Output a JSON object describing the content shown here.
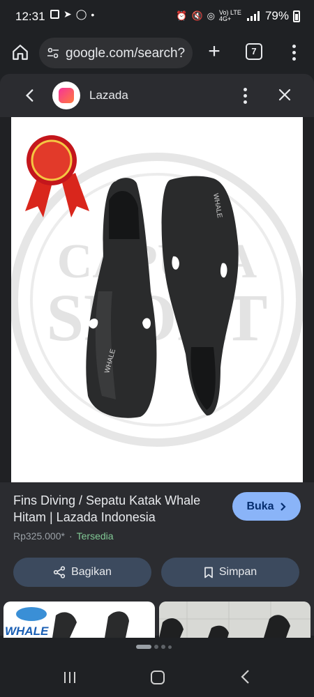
{
  "status_bar": {
    "time": "12:31",
    "battery": "79%",
    "network": "Vo) LTE 4G+"
  },
  "browser": {
    "url": "google.com/search?",
    "tab_count": "7"
  },
  "sheet": {
    "site_name": "Lazada"
  },
  "product": {
    "title": "Fins Diving / Sepatu Katak Whale Hitam | Lazada Indonesia",
    "price": "Rp325.000*",
    "separator": "·",
    "availability": "Tersedia",
    "visit_label": "Buka",
    "share_label": "Bagikan",
    "save_label": "Simpan",
    "image_watermark": [
      "CAPUTA",
      "SPORT"
    ],
    "fin_logo_text": "WHALE"
  },
  "related": {
    "thumb1_logo": "WHALE"
  },
  "colors": {
    "background": "#1f2124",
    "sheet": "#2b2c30",
    "primary_button": "#8ab4f8",
    "secondary_button": "#3c4a5e",
    "available": "#81c995"
  },
  "icons": [
    "home-icon",
    "tune-icon",
    "plus-icon",
    "tab-switcher-icon",
    "more-vert-icon",
    "back-arrow-icon",
    "lazada-logo-icon",
    "close-icon",
    "lens-icon",
    "chevron-right-icon",
    "share-icon",
    "bookmark-icon",
    "recents-icon",
    "nav-home-icon",
    "nav-back-icon"
  ]
}
